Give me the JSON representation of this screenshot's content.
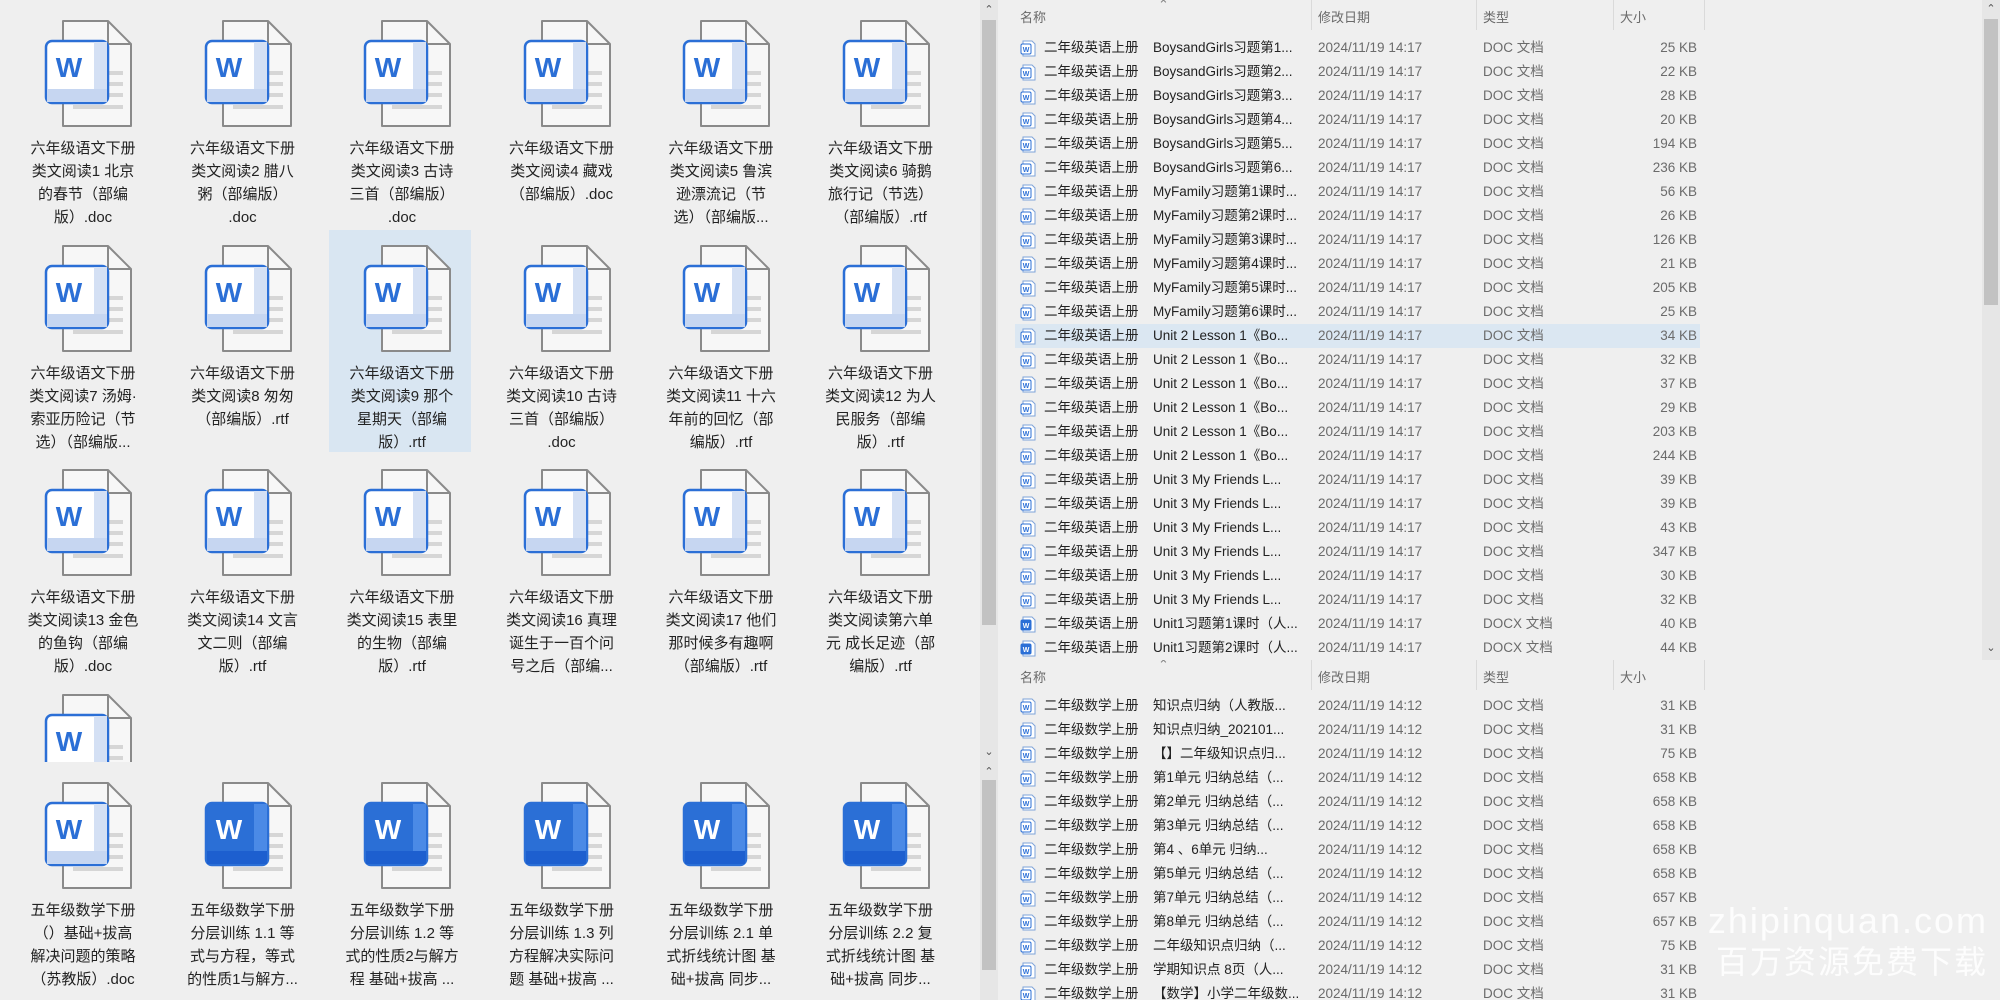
{
  "left_top": {
    "tiles": [
      {
        "label": "六年级语文下册\n类文阅读1 北京\n的春节（部编\n版）.doc",
        "style": "outline"
      },
      {
        "label": "六年级语文下册\n类文阅读2 腊八\n粥（部编版）\n.doc",
        "style": "outline"
      },
      {
        "label": "六年级语文下册\n类文阅读3 古诗\n三首（部编版）\n.doc",
        "style": "outline"
      },
      {
        "label": "六年级语文下册\n类文阅读4 藏戏\n（部编版）.doc",
        "style": "outline"
      },
      {
        "label": "六年级语文下册\n类文阅读5 鲁滨\n逊漂流记（节\n选）（部编版...",
        "style": "outline"
      },
      {
        "label": "六年级语文下册\n类文阅读6 骑鹅\n旅行记（节选）\n（部编版）.rtf",
        "style": "outline"
      },
      {
        "label": "六年级语文下册\n类文阅读7 汤姆·\n索亚历险记（节\n选）（部编版...",
        "style": "outline"
      },
      {
        "label": "六年级语文下册\n类文阅读8 匆匆\n（部编版）.rtf",
        "style": "outline"
      },
      {
        "label": "六年级语文下册\n类文阅读9 那个\n星期天（部编\n版）.rtf",
        "style": "outline",
        "selected": true
      },
      {
        "label": "六年级语文下册\n类文阅读10 古诗\n三首（部编版）\n.doc",
        "style": "outline"
      },
      {
        "label": "六年级语文下册\n类文阅读11 十六\n年前的回忆（部\n编版）.rtf",
        "style": "outline"
      },
      {
        "label": "六年级语文下册\n类文阅读12 为人\n民服务（部编\n版）.rtf",
        "style": "outline"
      },
      {
        "label": "六年级语文下册\n类文阅读13 金色\n的鱼钩（部编\n版）.doc",
        "style": "outline"
      },
      {
        "label": "六年级语文下册\n类文阅读14 文言\n文二则（部编\n版）.rtf",
        "style": "outline"
      },
      {
        "label": "六年级语文下册\n类文阅读15 表里\n的生物（部编\n版）.rtf",
        "style": "outline"
      },
      {
        "label": "六年级语文下册\n类文阅读16 真理\n诞生于一百个问\n号之后（部编...",
        "style": "outline"
      },
      {
        "label": "六年级语文下册\n类文阅读17 他们\n那时候多有趣啊\n（部编版）.rtf",
        "style": "outline"
      },
      {
        "label": "六年级语文下册\n类文阅读第六单\n元 成长足迹（部\n编版）.rtf",
        "style": "outline"
      },
      {
        "label": "",
        "style": "outline"
      }
    ]
  },
  "left_bottom": {
    "tiles": [
      {
        "label": "五年级数学下册\n（）基础+拔高\n解决问题的策略\n（苏教版）.doc",
        "style": "outline"
      },
      {
        "label": "五年级数学下册\n分层训练 1.1 等\n式与方程，等式\n的性质1与解方...",
        "style": "filled"
      },
      {
        "label": "五年级数学下册\n分层训练 1.2 等\n式的性质2与解方\n程 基础+拔高 ...",
        "style": "filled"
      },
      {
        "label": "五年级数学下册\n分层训练 1.3 列\n方程解决实际问\n题 基础+拔高 ...",
        "style": "filled"
      },
      {
        "label": "五年级数学下册\n分层训练 2.1 单\n式折线统计图 基\n础+拔高 同步...",
        "style": "filled"
      },
      {
        "label": "五年级数学下册\n分层训练 2.2 复\n式折线统计图 基\n础+拔高 同步...",
        "style": "filled"
      }
    ]
  },
  "columns": {
    "name": "名称",
    "date": "修改日期",
    "type": "类型",
    "size": "大小"
  },
  "list_top": [
    {
      "n1": "二年级英语上册",
      "n2": "BoysandGirls习题第1...",
      "date": "2024/11/19 14:17",
      "type": "DOC 文档",
      "size": "25 KB"
    },
    {
      "n1": "二年级英语上册",
      "n2": "BoysandGirls习题第2...",
      "date": "2024/11/19 14:17",
      "type": "DOC 文档",
      "size": "22 KB"
    },
    {
      "n1": "二年级英语上册",
      "n2": "BoysandGirls习题第3...",
      "date": "2024/11/19 14:17",
      "type": "DOC 文档",
      "size": "28 KB"
    },
    {
      "n1": "二年级英语上册",
      "n2": "BoysandGirls习题第4...",
      "date": "2024/11/19 14:17",
      "type": "DOC 文档",
      "size": "20 KB"
    },
    {
      "n1": "二年级英语上册",
      "n2": "BoysandGirls习题第5...",
      "date": "2024/11/19 14:17",
      "type": "DOC 文档",
      "size": "194 KB"
    },
    {
      "n1": "二年级英语上册",
      "n2": "BoysandGirls习题第6...",
      "date": "2024/11/19 14:17",
      "type": "DOC 文档",
      "size": "236 KB"
    },
    {
      "n1": "二年级英语上册",
      "n2": "MyFamily习题第1课时...",
      "date": "2024/11/19 14:17",
      "type": "DOC 文档",
      "size": "56 KB"
    },
    {
      "n1": "二年级英语上册",
      "n2": "MyFamily习题第2课时...",
      "date": "2024/11/19 14:17",
      "type": "DOC 文档",
      "size": "26 KB"
    },
    {
      "n1": "二年级英语上册",
      "n2": "MyFamily习题第3课时...",
      "date": "2024/11/19 14:17",
      "type": "DOC 文档",
      "size": "126 KB"
    },
    {
      "n1": "二年级英语上册",
      "n2": "MyFamily习题第4课时...",
      "date": "2024/11/19 14:17",
      "type": "DOC 文档",
      "size": "21 KB"
    },
    {
      "n1": "二年级英语上册",
      "n2": "MyFamily习题第5课时...",
      "date": "2024/11/19 14:17",
      "type": "DOC 文档",
      "size": "205 KB"
    },
    {
      "n1": "二年级英语上册",
      "n2": "MyFamily习题第6课时...",
      "date": "2024/11/19 14:17",
      "type": "DOC 文档",
      "size": "25 KB"
    },
    {
      "n1": "二年级英语上册",
      "n2": "Unit 2 Lesson 1《Bo...",
      "date": "2024/11/19 14:17",
      "type": "DOC 文档",
      "size": "34 KB",
      "selected": true
    },
    {
      "n1": "二年级英语上册",
      "n2": "Unit 2 Lesson 1《Bo...",
      "date": "2024/11/19 14:17",
      "type": "DOC 文档",
      "size": "32 KB"
    },
    {
      "n1": "二年级英语上册",
      "n2": "Unit 2 Lesson 1《Bo...",
      "date": "2024/11/19 14:17",
      "type": "DOC 文档",
      "size": "37 KB"
    },
    {
      "n1": "二年级英语上册",
      "n2": "Unit 2 Lesson 1《Bo...",
      "date": "2024/11/19 14:17",
      "type": "DOC 文档",
      "size": "29 KB"
    },
    {
      "n1": "二年级英语上册",
      "n2": "Unit 2 Lesson 1《Bo...",
      "date": "2024/11/19 14:17",
      "type": "DOC 文档",
      "size": "203 KB"
    },
    {
      "n1": "二年级英语上册",
      "n2": "Unit 2 Lesson 1《Bo...",
      "date": "2024/11/19 14:17",
      "type": "DOC 文档",
      "size": "244 KB"
    },
    {
      "n1": "二年级英语上册",
      "n2": "Unit 3 My Friends  L...",
      "date": "2024/11/19 14:17",
      "type": "DOC 文档",
      "size": "39 KB"
    },
    {
      "n1": "二年级英语上册",
      "n2": "Unit 3 My Friends  L...",
      "date": "2024/11/19 14:17",
      "type": "DOC 文档",
      "size": "39 KB"
    },
    {
      "n1": "二年级英语上册",
      "n2": "Unit 3 My Friends  L...",
      "date": "2024/11/19 14:17",
      "type": "DOC 文档",
      "size": "43 KB"
    },
    {
      "n1": "二年级英语上册",
      "n2": "Unit 3 My Friends  L...",
      "date": "2024/11/19 14:17",
      "type": "DOC 文档",
      "size": "347 KB"
    },
    {
      "n1": "二年级英语上册",
      "n2": "Unit 3 My Friends  L...",
      "date": "2024/11/19 14:17",
      "type": "DOC 文档",
      "size": "30 KB"
    },
    {
      "n1": "二年级英语上册",
      "n2": "Unit 3 My Friends  L...",
      "date": "2024/11/19 14:17",
      "type": "DOC 文档",
      "size": "32 KB"
    },
    {
      "n1": "二年级英语上册",
      "n2": "Unit1习题第1课时（人...",
      "date": "2024/11/19 14:17",
      "type": "DOCX 文档",
      "size": "40 KB",
      "docx": true
    },
    {
      "n1": "二年级英语上册",
      "n2": "Unit1习题第2课时（人...",
      "date": "2024/11/19 14:17",
      "type": "DOCX 文档",
      "size": "44 KB",
      "docx": true
    }
  ],
  "list_bottom": [
    {
      "n1": "二年级数学上册",
      "n2": " 知识点归纳（人教版...",
      "date": "2024/11/19 14:12",
      "type": "DOC 文档",
      "size": "31 KB"
    },
    {
      "n1": "二年级数学上册",
      "n2": " 知识点归纳_202101...",
      "date": "2024/11/19 14:12",
      "type": "DOC 文档",
      "size": "31 KB"
    },
    {
      "n1": "二年级数学上册",
      "n2": "【】二年级知识点归...",
      "date": "2024/11/19 14:12",
      "type": "DOC 文档",
      "size": "75 KB"
    },
    {
      "n1": "二年级数学上册",
      "n2": "第1单元  归纳总结（...",
      "date": "2024/11/19 14:12",
      "type": "DOC 文档",
      "size": "658 KB"
    },
    {
      "n1": "二年级数学上册",
      "n2": "第2单元  归纳总结（...",
      "date": "2024/11/19 14:12",
      "type": "DOC 文档",
      "size": "658 KB"
    },
    {
      "n1": "二年级数学上册",
      "n2": "第3单元  归纳总结（...",
      "date": "2024/11/19 14:12",
      "type": "DOC 文档",
      "size": "658 KB"
    },
    {
      "n1": "二年级数学上册",
      "n2": "第4 、6单元  归纳...",
      "date": "2024/11/19 14:12",
      "type": "DOC 文档",
      "size": "658 KB"
    },
    {
      "n1": "二年级数学上册",
      "n2": "第5单元  归纳总结（...",
      "date": "2024/11/19 14:12",
      "type": "DOC 文档",
      "size": "658 KB"
    },
    {
      "n1": "二年级数学上册",
      "n2": "第7单元  归纳总结（...",
      "date": "2024/11/19 14:12",
      "type": "DOC 文档",
      "size": "657 KB"
    },
    {
      "n1": "二年级数学上册",
      "n2": "第8单元  归纳总结（...",
      "date": "2024/11/19 14:12",
      "type": "DOC 文档",
      "size": "657 KB"
    },
    {
      "n1": "二年级数学上册",
      "n2": "二年级知识点归纳（...",
      "date": "2024/11/19 14:12",
      "type": "DOC 文档",
      "size": "75 KB"
    },
    {
      "n1": "二年级数学上册",
      "n2": "学期知识点 8页（人...",
      "date": "2024/11/19 14:12",
      "type": "DOC 文档",
      "size": "31 KB"
    },
    {
      "n1": "二年级数学上册",
      "n2": "【数学】小学二年级数...",
      "date": "2024/11/19 14:12",
      "type": "DOC 文档",
      "size": "31 KB"
    }
  ],
  "watermark": {
    "line1": "zhipinquan.com",
    "line2": "百万资源免费下载"
  },
  "colors": {
    "word_blue": "#2b6fd6",
    "word_blue_dark": "#1d5fcf",
    "selection": "#d9e6f2",
    "background": "#efefef"
  },
  "icons": {
    "sort": "chevron-up-icon",
    "scroll_up": "chevron-up-icon",
    "scroll_down": "chevron-down-icon",
    "file": "word-document-icon"
  }
}
